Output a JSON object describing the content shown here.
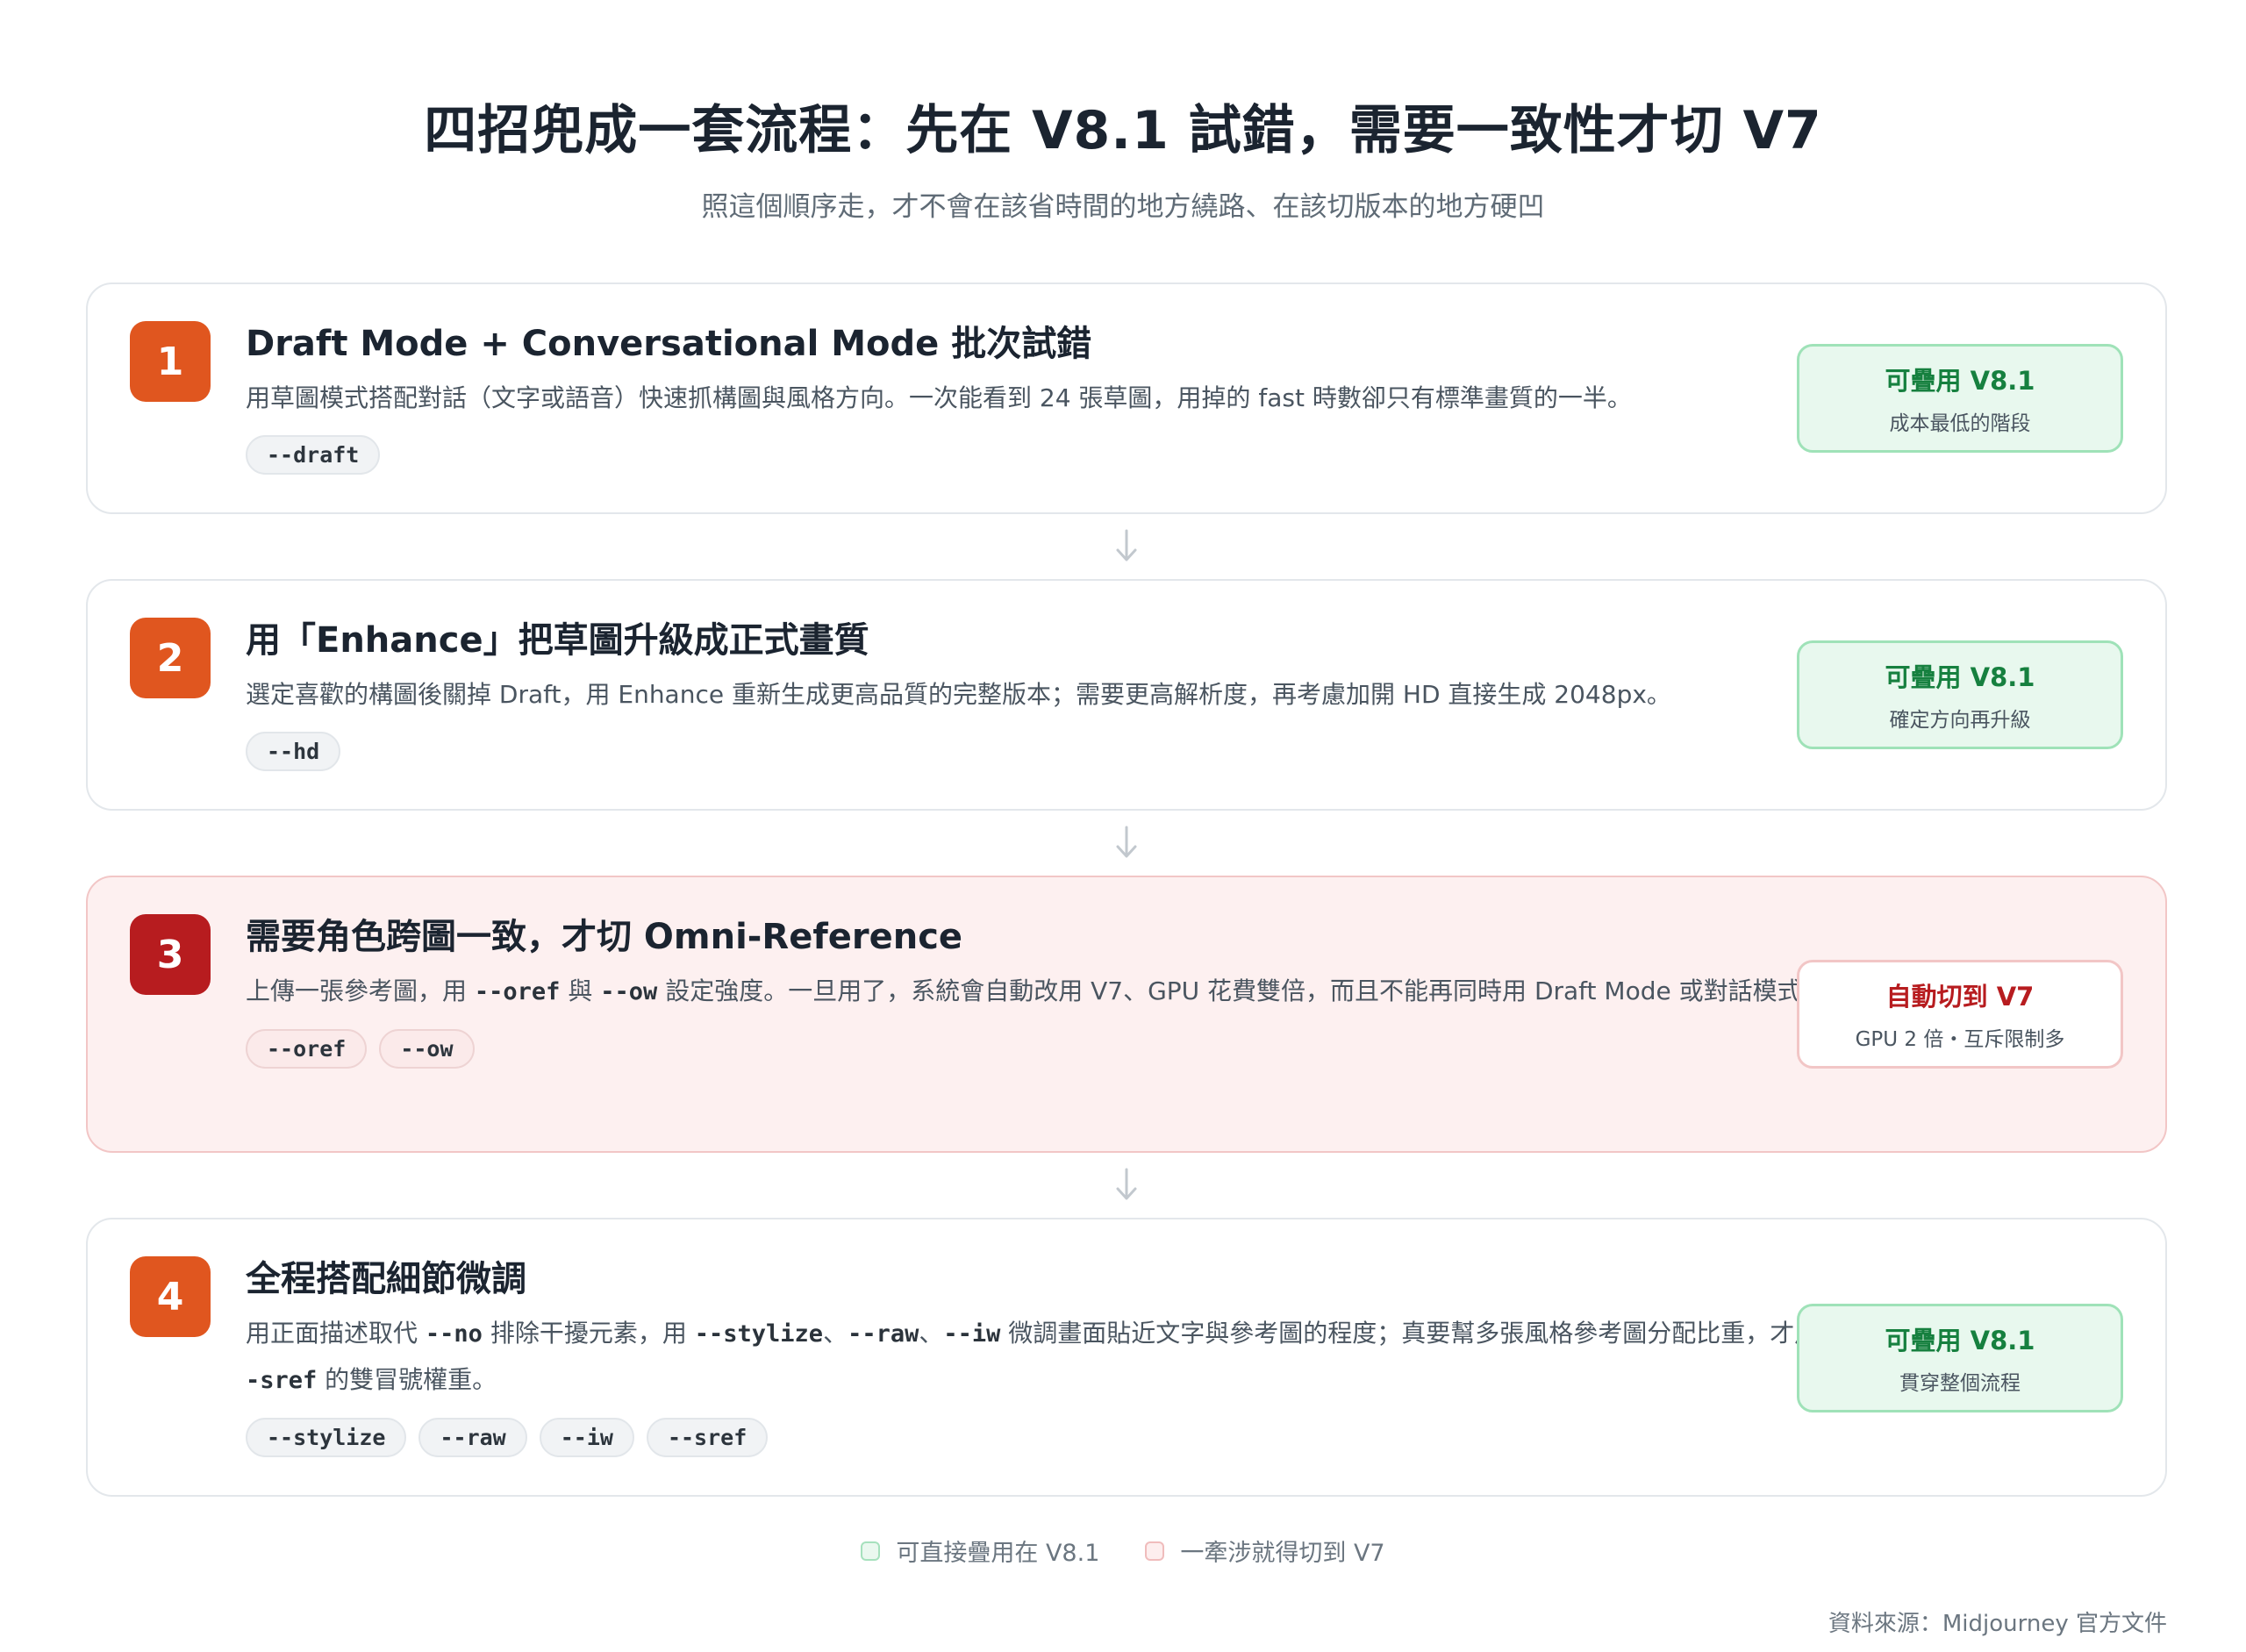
{
  "header": {
    "title": "四招兜成一套流程：先在 V8.1 試錯，需要一致性才切 V7",
    "subtitle": "照這個順序走，才不會在該省時間的地方繞路、在該切版本的地方硬凹"
  },
  "steps": [
    {
      "number": "1",
      "title": "Draft Mode + Conversational Mode 批次試錯",
      "desc": [
        {
          "t": "用草圖模式搭配對話（文字或語音）快速抓構圖與風格方向。一次能看到 24 張草圖，用掉的 fast 時數卻只有標準畫質的一半。"
        }
      ],
      "chips": [
        "--draft"
      ],
      "badge": {
        "title": "可疊用 V8.1",
        "sub": "成本最低的階段"
      }
    },
    {
      "number": "2",
      "title": "用「Enhance」把草圖升級成正式畫質",
      "desc": [
        {
          "t": "選定喜歡的構圖後關掉 Draft，用 Enhance 重新生成更高品質的完整版本；需要更高解析度，再考慮加開 HD 直接生成 2048px。"
        }
      ],
      "chips": [
        "--hd"
      ],
      "badge": {
        "title": "可疊用 V8.1",
        "sub": "確定方向再升級"
      }
    },
    {
      "number": "3",
      "title": "需要角色跨圖一致，才切 Omni-Reference",
      "desc": [
        {
          "t": "上傳一張參考圖，用 "
        },
        {
          "t": "--oref",
          "code": true
        },
        {
          "t": " 與 "
        },
        {
          "t": "--ow",
          "code": true
        },
        {
          "t": " 設定強度。一旦用了，系統會自動改用 V7、GPU 花費雙倍，而且不能再同時用 Draft Mode 或對話模式。"
        }
      ],
      "chips": [
        "--oref",
        "--ow"
      ],
      "badge": {
        "title": "自動切到 V7",
        "sub": "GPU 2 倍・互斥限制多"
      }
    },
    {
      "number": "4",
      "title": "全程搭配細節微調",
      "desc": [
        {
          "t": "用正面描述取代 "
        },
        {
          "t": "--no",
          "code": true
        },
        {
          "t": " 排除干擾元素，用 "
        },
        {
          "t": "--stylize",
          "code": true
        },
        {
          "t": "、"
        },
        {
          "t": "--raw",
          "code": true
        },
        {
          "t": "、"
        },
        {
          "t": "--iw",
          "code": true
        },
        {
          "t": " 微調畫面貼近文字與參考圖的程度；真要幫多張風格參考圖分配比重，才用 "
        },
        {
          "t": "--sref",
          "code": true
        },
        {
          "t": " 的雙冒號權重。"
        }
      ],
      "chips": [
        "--stylize",
        "--raw",
        "--iw",
        "--sref"
      ],
      "badge": {
        "title": "可疊用 V8.1",
        "sub": "貫穿整個流程"
      }
    }
  ],
  "legend": {
    "green_label": "可直接疊用在 V8.1",
    "red_label": "一牽涉就得切到 V7"
  },
  "footer": {
    "source": "資料來源：Midjourney 官方文件"
  },
  "colors": {
    "step_accent": "#e0561f",
    "warn_accent": "#b71c1f",
    "ok_green": "#16803f",
    "warn_card_bg": "#fdf0f0"
  }
}
